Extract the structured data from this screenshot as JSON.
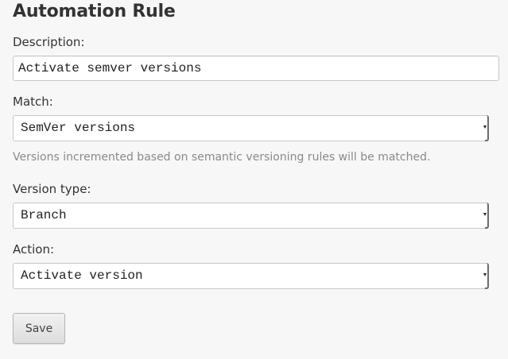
{
  "form": {
    "title": "Automation Rule",
    "description": {
      "label": "Description:",
      "value": "Activate semver versions"
    },
    "match": {
      "label": "Match:",
      "selected": "SemVer versions",
      "help": "Versions incremented based on semantic versioning rules will be matched."
    },
    "version_type": {
      "label": "Version type:",
      "selected": "Branch"
    },
    "action": {
      "label": "Action:",
      "selected": "Activate version"
    },
    "save_label": "Save"
  }
}
